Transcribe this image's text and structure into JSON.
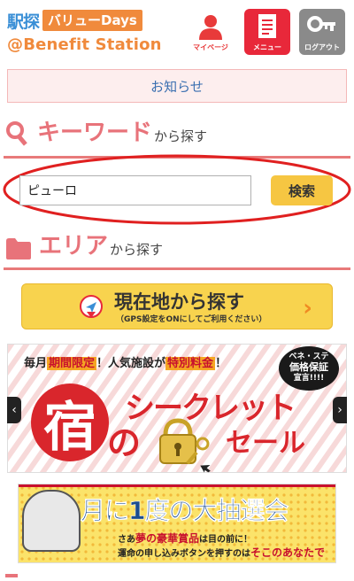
{
  "header": {
    "logo_eki": "駅探",
    "logo_value": "バリューDays",
    "logo_station": "@Benefit Station",
    "mypage_label": "マイページ",
    "menu_label": "メニュー",
    "logout_label": "ログアウト"
  },
  "notice": {
    "label": "お知らせ"
  },
  "keyword_section": {
    "title_big": "キーワード",
    "title_small": "から探す",
    "input_value": "ピューロ",
    "search_button": "検索"
  },
  "area_section": {
    "title_big": "エリア",
    "title_small": "から探す"
  },
  "location_button": {
    "main": "現在地から探す",
    "sub": "（GPS設定をONにしてご利用ください）",
    "arrow": "›"
  },
  "banner_secret": {
    "top_prefix": "毎月",
    "top_limited": "期間限定",
    "top_mid": "！人気施設が",
    "top_special": "特別料金",
    "top_suffix": "！",
    "badge_line1": "ベネ・ステ",
    "badge_line2": "価格保証",
    "badge_line3": "宣言!!!!",
    "yado": "宿",
    "no": "の",
    "secret": "シークレット",
    "sale": "セール",
    "arrow_left": "‹",
    "arrow_right": "›"
  },
  "banner_lottery": {
    "title": "月に1度の大抽選会",
    "line1_prefix": "さあ",
    "line1_red": "夢の豪華賞品",
    "line1_suffix": "は目の前に！",
    "line2_prefix": "運命の申し込みボタンを押すのは",
    "line2_red": "そこのあなたです！"
  },
  "colors": {
    "accent_red": "#e8283a",
    "heading_pink": "#e8737a",
    "button_yellow": "#f6c642",
    "link_blue": "#3a6fb0",
    "logo_orange": "#f08a3c"
  }
}
